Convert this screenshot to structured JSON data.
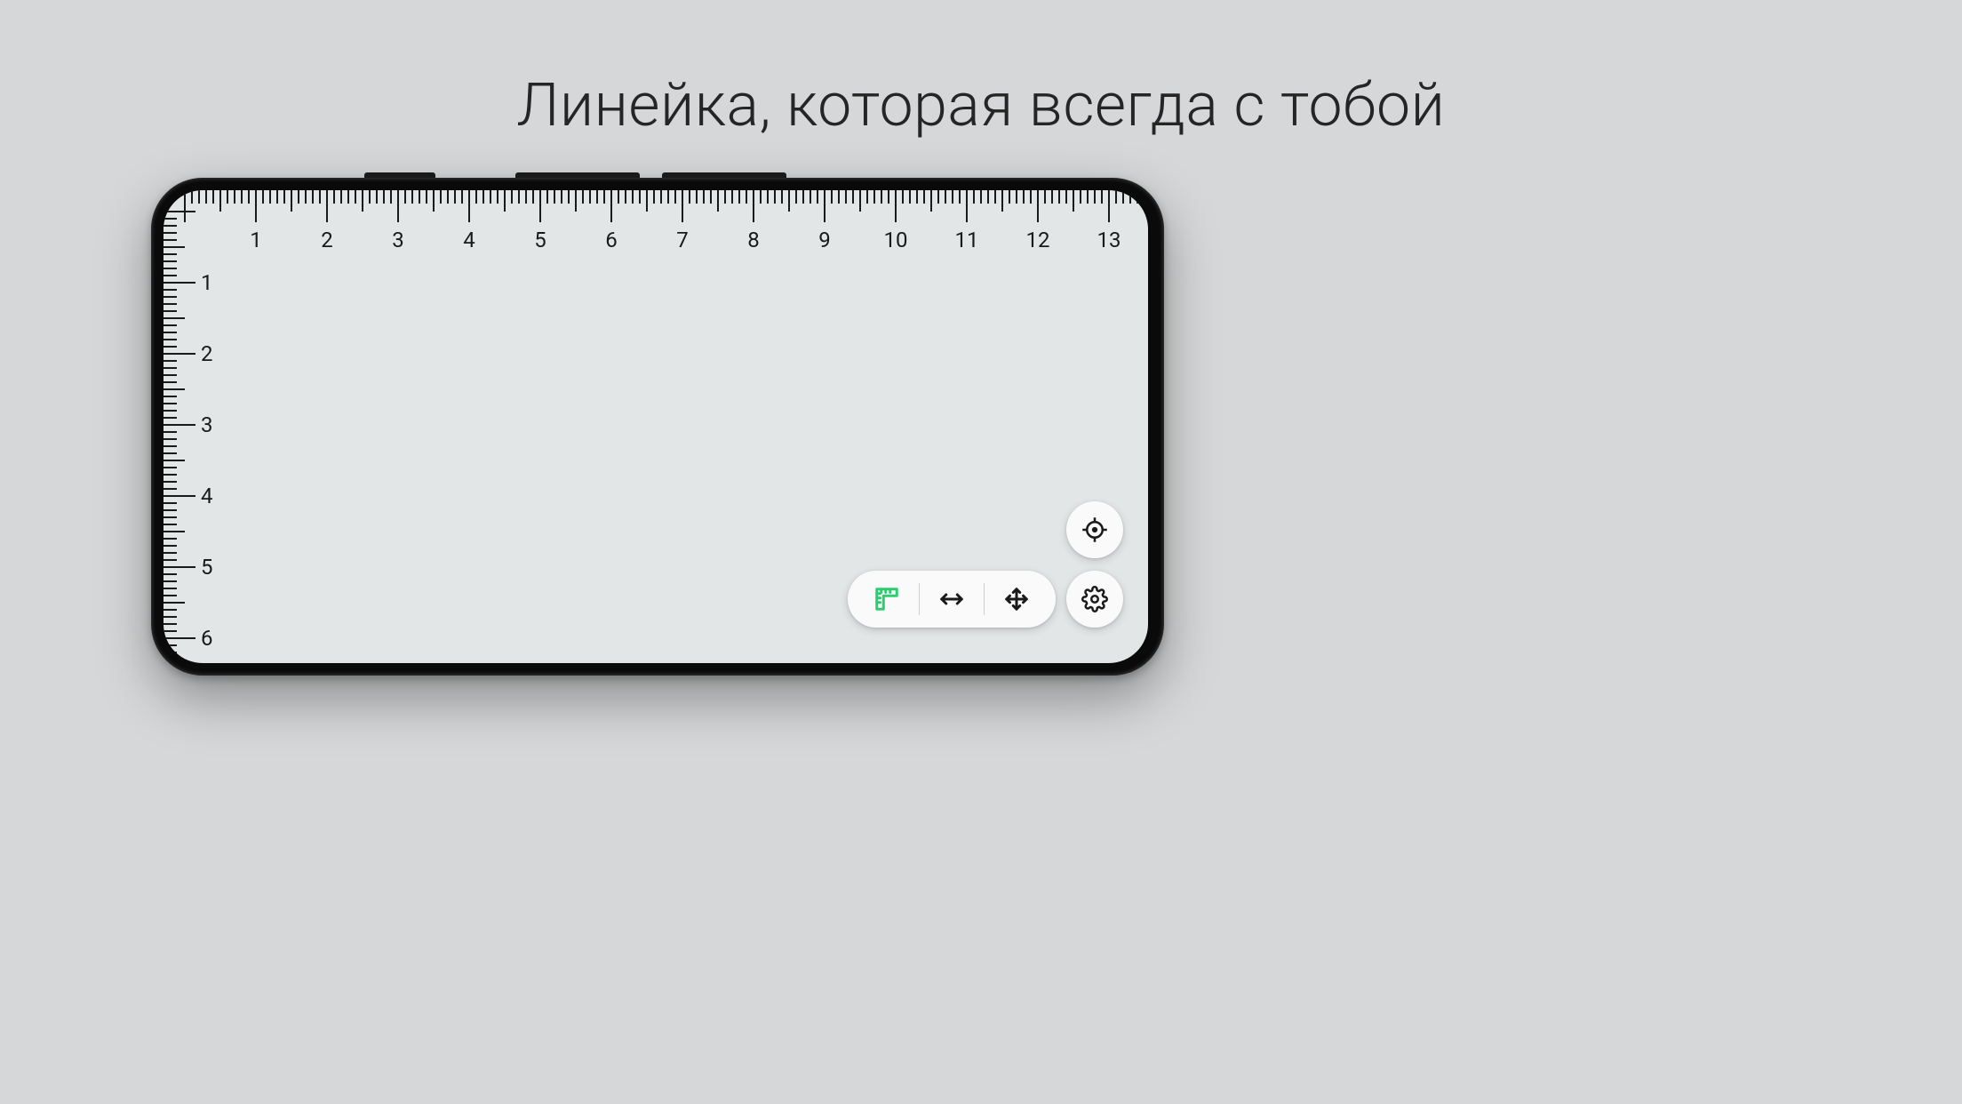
{
  "headline": "Линейка, которая всегда с тобой",
  "ruler": {
    "h_numbers": [
      "1",
      "2",
      "3",
      "4",
      "5",
      "6",
      "7",
      "8",
      "9",
      "10",
      "11",
      "12",
      "13"
    ],
    "v_numbers": [
      "1",
      "2",
      "3",
      "4",
      "5",
      "6"
    ]
  },
  "toolbar": {
    "mode_2d_hint": "2D",
    "mode_horizontal_hint": "↔",
    "mode_move_hint": "✥"
  },
  "fab": {
    "calibrate_hint": "calibrate",
    "settings_hint": "settings"
  },
  "colors": {
    "accent": "#2ecc71",
    "ink": "#1a1a1a",
    "screen_bg": "#e3e6e7"
  }
}
